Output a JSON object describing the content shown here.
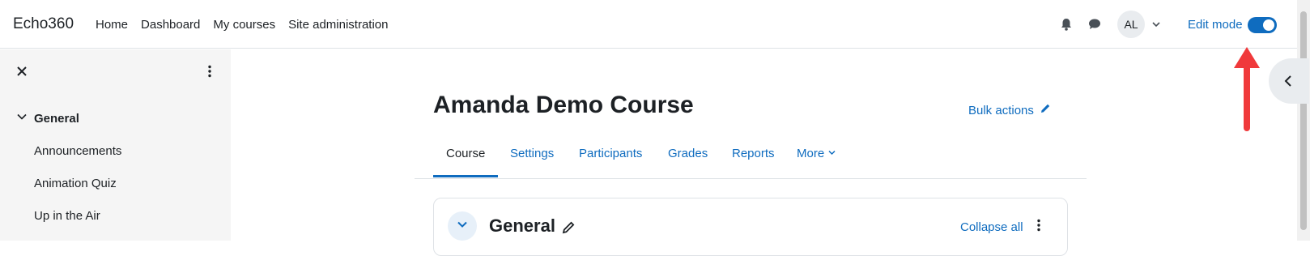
{
  "navbar": {
    "brand": "Echo360",
    "links": [
      "Home",
      "Dashboard",
      "My courses",
      "Site administration"
    ],
    "avatar_initials": "AL",
    "edit_mode_label": "Edit mode",
    "edit_mode_on": true
  },
  "drawer": {
    "section_label": "General",
    "items": [
      "Announcements",
      "Animation Quiz",
      "Up in the Air"
    ]
  },
  "main": {
    "course_title": "Amanda Demo Course",
    "bulk_actions_label": "Bulk actions",
    "tabs": [
      "Course",
      "Settings",
      "Participants",
      "Grades",
      "Reports",
      "More"
    ],
    "active_tab": "Course",
    "section": {
      "title": "General",
      "collapse_all_label": "Collapse all"
    }
  },
  "icons": {
    "notifications": "bell-icon",
    "messages": "chat-bubble-icon",
    "user_menu": "chevron-down-icon",
    "drawer_close": "close-icon",
    "drawer_menu": "kebab-menu-icon",
    "section_toggle": "chevron-down-icon",
    "edit": "pencil-icon",
    "right_drawer": "chevron-left-icon"
  },
  "colors": {
    "accent": "#0f6cbf",
    "annotation": "#f0393b",
    "drawer_bg": "#f5f5f5"
  }
}
